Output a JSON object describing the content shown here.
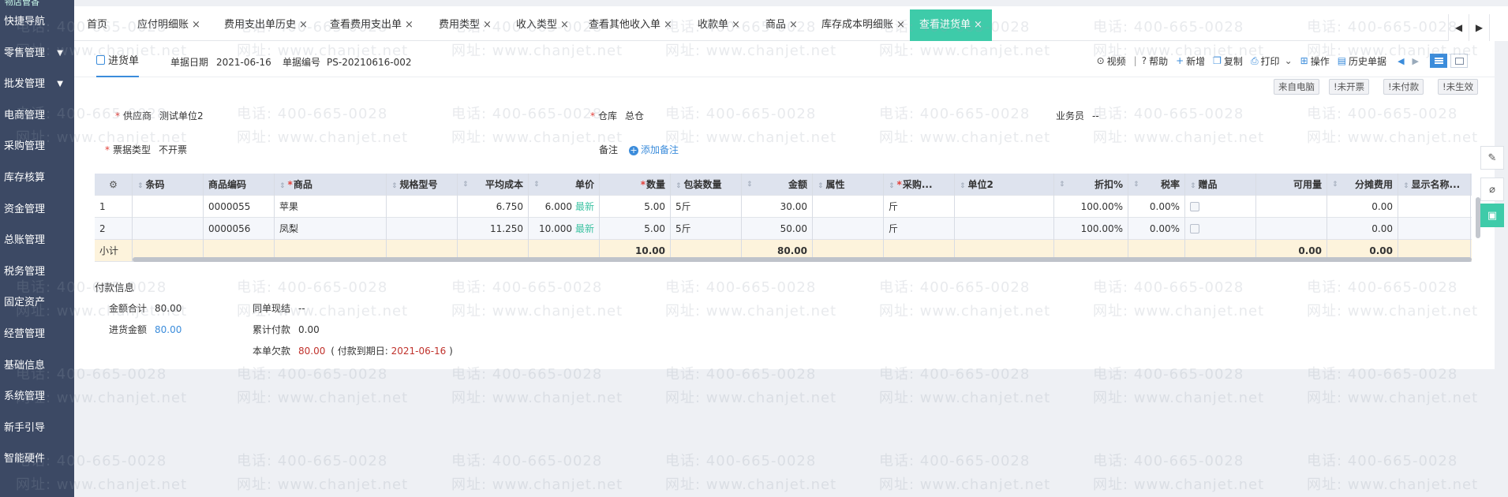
{
  "sidebar": {
    "top_partial": "物店管香",
    "items": [
      {
        "label": "快捷导航",
        "caret": false
      },
      {
        "label": "零售管理",
        "caret": true
      },
      {
        "label": "批发管理",
        "caret": true
      },
      {
        "label": "电商管理",
        "caret": false
      },
      {
        "label": "采购管理",
        "caret": false
      },
      {
        "label": "库存核算",
        "caret": false
      },
      {
        "label": "资金管理",
        "caret": false
      },
      {
        "label": "总账管理",
        "caret": false
      },
      {
        "label": "税务管理",
        "caret": false
      },
      {
        "label": "固定资产",
        "caret": false
      },
      {
        "label": "经营管理",
        "caret": false
      },
      {
        "label": "基础信息",
        "caret": false
      },
      {
        "label": "系统管理",
        "caret": false
      },
      {
        "label": "新手引导",
        "caret": false
      },
      {
        "label": "智能硬件",
        "caret": false
      }
    ]
  },
  "tabs": [
    {
      "label": "首页",
      "closable": false
    },
    {
      "label": "应付明细账",
      "closable": true
    },
    {
      "label": "费用支出单历史",
      "closable": true
    },
    {
      "label": "查看费用支出单",
      "closable": true
    },
    {
      "label": "费用类型",
      "closable": true
    },
    {
      "label": "收入类型",
      "closable": true
    },
    {
      "label": "查看其他收入单",
      "closable": true
    },
    {
      "label": "收款单",
      "closable": true
    },
    {
      "label": "商品",
      "closable": true
    },
    {
      "label": "库存成本明细账",
      "closable": true
    },
    {
      "label": "查看进货单",
      "closable": true,
      "active": true
    }
  ],
  "tab_close_glyph": "×",
  "tab_nav": {
    "prev": "◀",
    "next": "▶"
  },
  "doc": {
    "tab_label": "进货单",
    "date_label": "单据日期",
    "date_value": "2021-06-16",
    "number_label": "单据编号",
    "number_value": "PS-20210616-002"
  },
  "toolbar": {
    "video": "视频",
    "help": "帮助",
    "add": "新增",
    "copy": "复制",
    "print": "打印",
    "operate": "操作",
    "history": "历史单据"
  },
  "badges": {
    "source": "来自电脑",
    "invoice": "!未开票",
    "payment": "!未付款",
    "effect": "!未生效"
  },
  "form": {
    "supplier_label": "供应商",
    "supplier_value": "测试单位2",
    "warehouse_label": "仓库",
    "warehouse_value": "总仓",
    "salesman_label": "业务员",
    "salesman_value": "--",
    "invoice_type_label": "票据类型",
    "invoice_type_value": "不开票",
    "remark_label": "备注",
    "add_remark": "添加备注"
  },
  "grid": {
    "columns": [
      "条码",
      "商品编码",
      "商品",
      "规格型号",
      "平均成本",
      "单价",
      "数量",
      "包装数量",
      "金额",
      "属性",
      "采购...",
      "单位2",
      "折扣%",
      "税率",
      "赠品",
      "可用量",
      "分摊费用",
      "显示名称..."
    ],
    "rows": [
      {
        "idx": "1",
        "barcode": "",
        "code": "0000055",
        "name": "苹果",
        "spec": "",
        "avg_cost": "6.750",
        "price": "6.000",
        "latest": "最新",
        "qty": "5.00",
        "pack_qty": "5斤",
        "amount": "30.00",
        "attr": "",
        "purchase_unit": "斤",
        "unit2": "",
        "discount": "100.00%",
        "tax": "0.00%",
        "gift": "",
        "available": "",
        "alloc": "0.00",
        "display": ""
      },
      {
        "idx": "2",
        "barcode": "",
        "code": "0000056",
        "name": "凤梨",
        "spec": "",
        "avg_cost": "11.250",
        "price": "10.000",
        "latest": "最新",
        "qty": "5.00",
        "pack_qty": "5斤",
        "amount": "50.00",
        "attr": "",
        "purchase_unit": "斤",
        "unit2": "",
        "discount": "100.00%",
        "tax": "0.00%",
        "gift": "",
        "available": "",
        "alloc": "0.00",
        "display": ""
      }
    ],
    "subtotal": {
      "label": "小计",
      "qty": "10.00",
      "amount": "80.00",
      "available": "0.00",
      "alloc": "0.00"
    }
  },
  "payment": {
    "title": "付款信息",
    "total_label": "金额合计",
    "total_value": "80.00",
    "purchase_label": "进货金额",
    "purchase_value": "80.00",
    "same_cash_label": "同单现结",
    "same_cash_value": "--",
    "accum_label": "累计付款",
    "accum_value": "0.00",
    "owed_label": "本单欠款",
    "owed_value": "80.00",
    "due_prefix": "( 付款到期日:",
    "due_date": "2021-06-16",
    "due_suffix": ")"
  },
  "watermark": {
    "phone": "电话: 400-665-0028",
    "site": "网址: www.chanjet.net"
  }
}
